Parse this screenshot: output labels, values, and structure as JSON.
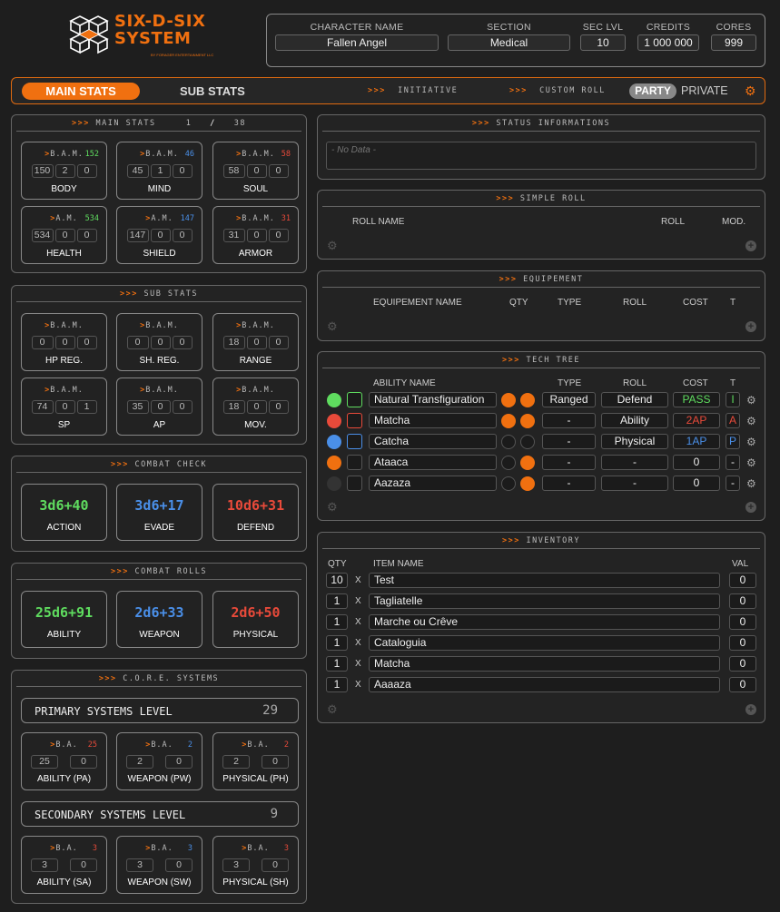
{
  "logo": {
    "line1": "SIX-D-SIX",
    "line2": "SYSTEM",
    "sub": "BY FORAGER ENTERTAINMENT LLC"
  },
  "character": {
    "name_label": "CHARACTER NAME",
    "name": "Fallen Angel",
    "section_label": "SECTION",
    "section": "Medical",
    "seclvl_label": "SEC LVL",
    "seclvl": "10",
    "credits_label": "CREDITS",
    "credits": "1 000 000",
    "cores_label": "CORES",
    "cores": "999"
  },
  "tabs": {
    "main": "MAIN STATS",
    "sub": "SUB STATS",
    "initiative": "INITIATIVE",
    "custom_roll": "CUSTOM ROLL",
    "party": "PARTY",
    "private": "PRIVATE",
    "arrows": ">>>"
  },
  "main_stats": {
    "title": "MAIN STATS",
    "count": "1",
    "slash": "/",
    "total": "38",
    "items": [
      {
        "hd": "B.A.M.",
        "num": "152",
        "color": "#5fdc5f",
        "vals": [
          "150",
          "2",
          "0"
        ],
        "name": "BODY"
      },
      {
        "hd": "B.A.M.",
        "num": "46",
        "color": "#4a8fe8",
        "vals": [
          "45",
          "1",
          "0"
        ],
        "name": "MIND"
      },
      {
        "hd": "B.A.M.",
        "num": "58",
        "color": "#e84a3a",
        "vals": [
          "58",
          "0",
          "0"
        ],
        "name": "SOUL"
      },
      {
        "hd": "A.M.",
        "num": "534",
        "color": "#5fdc5f",
        "vals": [
          "534",
          "0",
          "0"
        ],
        "name": "HEALTH"
      },
      {
        "hd": "A.M.",
        "num": "147",
        "color": "#4a8fe8",
        "vals": [
          "147",
          "0",
          "0"
        ],
        "name": "SHIELD"
      },
      {
        "hd": "B.A.M.",
        "num": "31",
        "color": "#e84a3a",
        "vals": [
          "31",
          "0",
          "0"
        ],
        "name": "ARMOR"
      }
    ]
  },
  "sub_stats": {
    "title": "SUB STATS",
    "items": [
      {
        "hd": "B.A.M.",
        "vals": [
          "0",
          "0",
          "0"
        ],
        "name": "HP REG."
      },
      {
        "hd": "B.A.M.",
        "vals": [
          "0",
          "0",
          "0"
        ],
        "name": "SH. REG."
      },
      {
        "hd": "B.A.M.",
        "vals": [
          "18",
          "0",
          "0"
        ],
        "name": "RANGE"
      },
      {
        "hd": "B.A.M.",
        "vals": [
          "74",
          "0",
          "1"
        ],
        "name": "SP"
      },
      {
        "hd": "B.A.M.",
        "vals": [
          "35",
          "0",
          "0"
        ],
        "name": "AP"
      },
      {
        "hd": "B.A.M.",
        "vals": [
          "18",
          "0",
          "0"
        ],
        "name": "MOV."
      }
    ]
  },
  "combat_check": {
    "title": "COMBAT CHECK",
    "items": [
      {
        "value": "3d6+40",
        "color": "#5fdc5f",
        "name": "ACTION"
      },
      {
        "value": "3d6+17",
        "color": "#4a8fe8",
        "name": "EVADE"
      },
      {
        "value": "10d6+31",
        "color": "#e84a3a",
        "name": "DEFEND"
      }
    ]
  },
  "combat_rolls": {
    "title": "COMBAT ROLLS",
    "items": [
      {
        "value": "25d6+91",
        "color": "#5fdc5f",
        "name": "ABILITY"
      },
      {
        "value": "2d6+33",
        "color": "#4a8fe8",
        "name": "WEAPON"
      },
      {
        "value": "2d6+50",
        "color": "#e84a3a",
        "name": "PHYSICAL"
      }
    ]
  },
  "core_systems": {
    "title": "C.O.R.E. SYSTEMS",
    "primary_label": "PRIMARY SYSTEMS LEVEL",
    "primary_level": "29",
    "secondary_label": "SECONDARY SYSTEMS LEVEL",
    "secondary_level": "9",
    "primary": [
      {
        "hd": "B.A.",
        "num": "25",
        "color": "#e84a3a",
        "vals": [
          "25",
          "0"
        ],
        "name": "ABILITY (PA)"
      },
      {
        "hd": "B.A.",
        "num": "2",
        "color": "#4a8fe8",
        "vals": [
          "2",
          "0"
        ],
        "name": "WEAPON (PW)"
      },
      {
        "hd": "B.A.",
        "num": "2",
        "color": "#e84a3a",
        "vals": [
          "2",
          "0"
        ],
        "name": "PHYSICAL (PH)"
      }
    ],
    "secondary": [
      {
        "hd": "B.A.",
        "num": "3",
        "color": "#e84a3a",
        "vals": [
          "3",
          "0"
        ],
        "name": "ABILITY (SA)"
      },
      {
        "hd": "B.A.",
        "num": "3",
        "color": "#4a8fe8",
        "vals": [
          "3",
          "0"
        ],
        "name": "WEAPON (SW)"
      },
      {
        "hd": "B.A.",
        "num": "3",
        "color": "#e84a3a",
        "vals": [
          "3",
          "0"
        ],
        "name": "PHYSICAL (SH)"
      }
    ]
  },
  "status": {
    "title": "STATUS INFORMATIONS",
    "placeholder": "- No Data -"
  },
  "simple_roll": {
    "title": "SIMPLE ROLL",
    "col_name": "ROLL NAME",
    "col_roll": "ROLL",
    "col_mod": "MOD."
  },
  "equipement": {
    "title": "EQUIPEMENT",
    "col_name": "EQUIPEMENT NAME",
    "col_qty": "QTY",
    "col_type": "TYPE",
    "col_roll": "ROLL",
    "col_cost": "COST",
    "col_t": "T"
  },
  "tech_tree": {
    "title": "TECH TREE",
    "col_name": "ABILITY NAME",
    "col_type": "TYPE",
    "col_roll": "ROLL",
    "col_cost": "COST",
    "col_t": "T",
    "rows": [
      {
        "color": "#5fdc5f",
        "name": "Natural Transfiguration",
        "o1": true,
        "o2": true,
        "type": "Ranged",
        "roll": "Defend",
        "cost": "PASS",
        "cost_color": "#5fdc5f",
        "t": "I",
        "t_color": "#5fdc5f"
      },
      {
        "color": "#e84a3a",
        "name": "Matcha",
        "o1": true,
        "o2": true,
        "type": "-",
        "roll": "Ability",
        "cost": "2AP",
        "cost_color": "#e84a3a",
        "t": "A",
        "t_color": "#e84a3a"
      },
      {
        "color": "#4a8fe8",
        "name": "Catcha",
        "o1": false,
        "o2": false,
        "type": "-",
        "roll": "Physical",
        "cost": "1AP",
        "cost_color": "#4a8fe8",
        "t": "P",
        "t_color": "#4a8fe8"
      },
      {
        "color": "#f07010",
        "name": "Ataaca",
        "o1": false,
        "o2": true,
        "type": "-",
        "roll": "-",
        "cost": "0",
        "cost_color": "#eeeeee",
        "t": "-",
        "t_color": "#eeeeee"
      },
      {
        "color": "#333333",
        "name": "Aazaza",
        "o1": false,
        "o2": true,
        "type": "-",
        "roll": "-",
        "cost": "0",
        "cost_color": "#eeeeee",
        "t": "-",
        "t_color": "#eeeeee"
      }
    ]
  },
  "inventory": {
    "title": "INVENTORY",
    "col_qty": "QTY",
    "col_name": "ITEM NAME",
    "col_val": "VAL",
    "x": "X",
    "rows": [
      {
        "qty": "10",
        "name": "Test",
        "val": "0"
      },
      {
        "qty": "1",
        "name": "Tagliatelle",
        "val": "0"
      },
      {
        "qty": "1",
        "name": "Marche ou Crêve",
        "val": "0"
      },
      {
        "qty": "1",
        "name": "Cataloguia",
        "val": "0"
      },
      {
        "qty": "1",
        "name": "Matcha",
        "val": "0"
      },
      {
        "qty": "1",
        "name": "Aaaaza",
        "val": "0"
      }
    ]
  }
}
